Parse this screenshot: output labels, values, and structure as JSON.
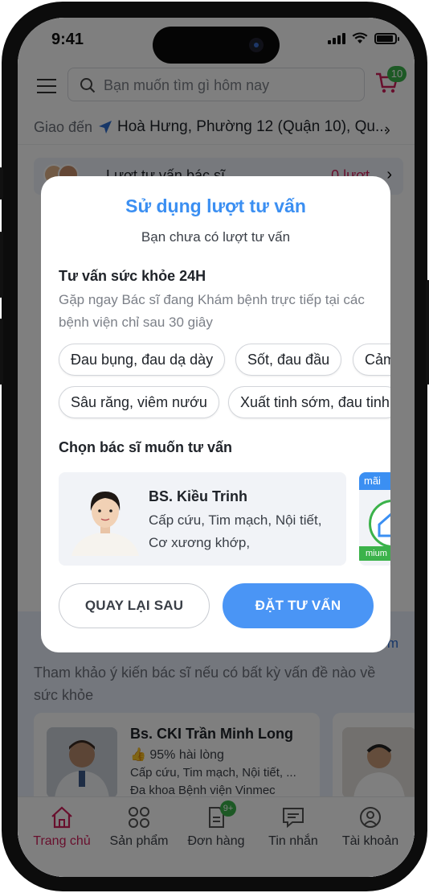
{
  "status_bar": {
    "time": "9:41"
  },
  "header": {
    "search_placeholder": "Bạn muốn tìm gì hôm nay",
    "cart_badge": "10"
  },
  "delivery": {
    "label": "Giao đến",
    "address": "Hoà Hưng, Phường 12 (Quận 10), Qu..."
  },
  "quota": {
    "label": "Lượt tư vấn bác sĩ",
    "value": "0 lượt"
  },
  "background_section": {
    "more": "Xem",
    "description": "Tham khảo ý kiến bác sĩ nếu có bất kỳ vấn đề nào về sức khỏe",
    "doctor": {
      "name": "Bs. CKI Trần Minh Long",
      "rating": "95% hài lòng",
      "specialty": "Cấp cứu, Tim mạch, Nội tiết, ...",
      "hospital": "Đa khoa Bệnh viện Vinmec"
    }
  },
  "bottom_nav": {
    "items": [
      {
        "label": "Trang chủ",
        "icon": "home-icon",
        "active": true
      },
      {
        "label": "Sản phẩm",
        "icon": "grid-icon",
        "active": false
      },
      {
        "label": "Đơn hàng",
        "icon": "order-icon",
        "active": false,
        "badge": "9+"
      },
      {
        "label": "Tin nhắn",
        "icon": "chat-icon",
        "active": false
      },
      {
        "label": "Tài khoản",
        "icon": "user-icon",
        "active": false
      }
    ]
  },
  "modal": {
    "title": "Sử dụng lượt tư vấn",
    "subtitle": "Bạn chưa có lượt tư vấn",
    "section1_title": "Tư vấn sức khỏe 24H",
    "section1_desc": "Gặp ngay Bác sĩ đang Khám bệnh trực tiếp tại các bệnh viện chỉ sau 30 giây",
    "chips": [
      "Đau bụng, đau dạ dày",
      "Sốt, đau đầu",
      "Cảm",
      "Sâu răng, viêm nướu",
      "Xuất tinh sớm, đau tinh"
    ],
    "section2_title": "Chọn bác sĩ muốn tư vấn",
    "doctor": {
      "name": "BS. Kiều Trinh",
      "specialty": "Cấp cứu, Tim mạch, Nội tiết, Cơ xương khớp,"
    },
    "doctor2": {
      "promo": "mãi",
      "premium": "mium"
    },
    "back_label": "QUAY LẠI SAU",
    "book_label": "ĐẶT TƯ VẤN"
  },
  "colors": {
    "primary": "#3b8ff2",
    "accent": "#d01f5b",
    "green": "#3bb24a"
  }
}
